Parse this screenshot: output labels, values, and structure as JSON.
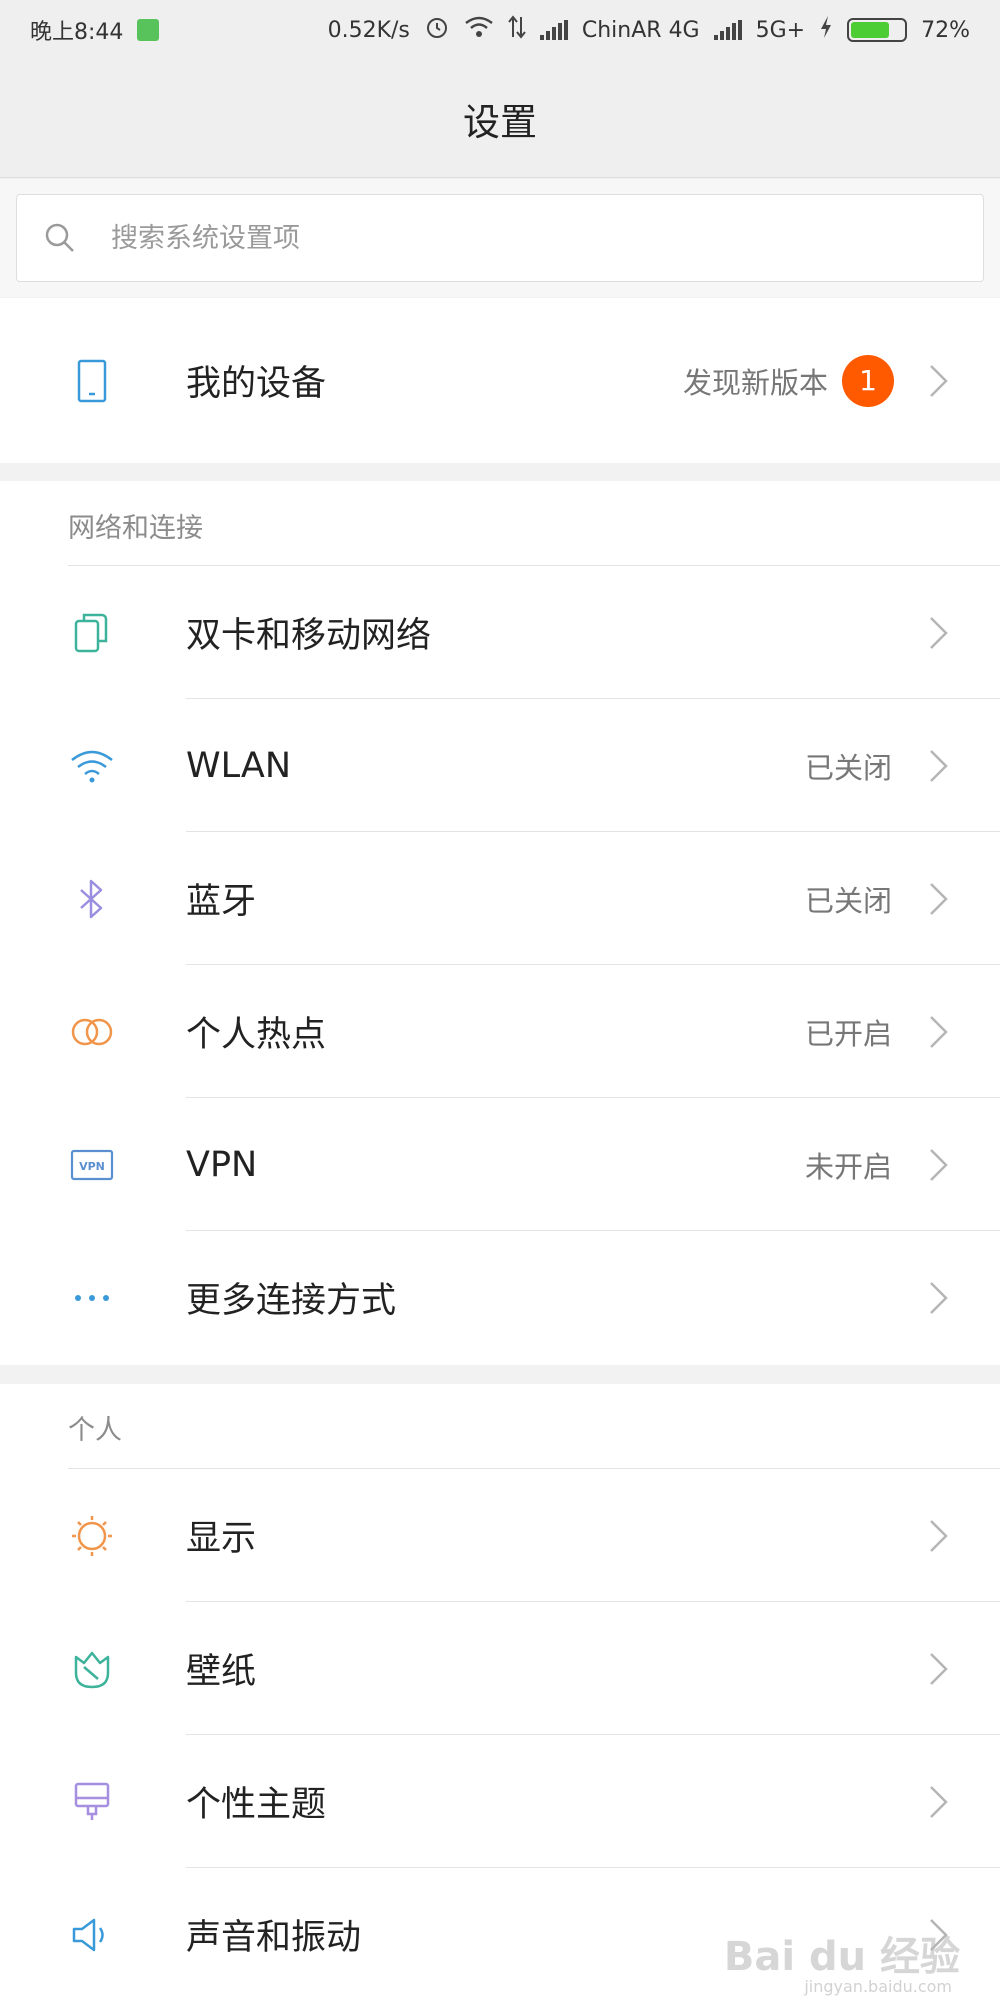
{
  "status_bar": {
    "time": "晚上8:44",
    "net_speed": "0.52K/s",
    "carrier": "ChinAR 4G",
    "network2": "5G+",
    "battery": "72%",
    "battery_level": 0.72
  },
  "header": {
    "title": "设置"
  },
  "search": {
    "placeholder": "搜索系统设置项"
  },
  "device": {
    "label": "我的设备",
    "update_text": "发现新版本",
    "badge": "1"
  },
  "network_section": {
    "title": "网络和连接",
    "items": [
      {
        "label": "双卡和移动网络",
        "value": "",
        "icon": "sim-card-icon",
        "color": "#3cb39a"
      },
      {
        "label": "WLAN",
        "value": "已关闭",
        "icon": "wifi-icon",
        "color": "#3a9ad9"
      },
      {
        "label": "蓝牙",
        "value": "已关闭",
        "icon": "bluetooth-icon",
        "color": "#9a8ee0"
      },
      {
        "label": "个人热点",
        "value": "已开启",
        "icon": "hotspot-icon",
        "color": "#f0954a"
      },
      {
        "label": "VPN",
        "value": "未开启",
        "icon": "vpn-icon",
        "color": "#5a8fd0"
      },
      {
        "label": "更多连接方式",
        "value": "",
        "icon": "more-icon",
        "color": "#3a9ad9"
      }
    ]
  },
  "personal_section": {
    "title": "个人",
    "items": [
      {
        "label": "显示",
        "icon": "brightness-icon",
        "color": "#f0954a"
      },
      {
        "label": "壁纸",
        "icon": "wallpaper-icon",
        "color": "#3cb39a"
      },
      {
        "label": "个性主题",
        "icon": "theme-icon",
        "color": "#a68ee0"
      },
      {
        "label": "声音和振动",
        "icon": "sound-icon",
        "color": "#3a9ad9"
      }
    ]
  },
  "watermark": {
    "text": "Bai du 经验",
    "sub": "jingyan.baidu.com"
  }
}
